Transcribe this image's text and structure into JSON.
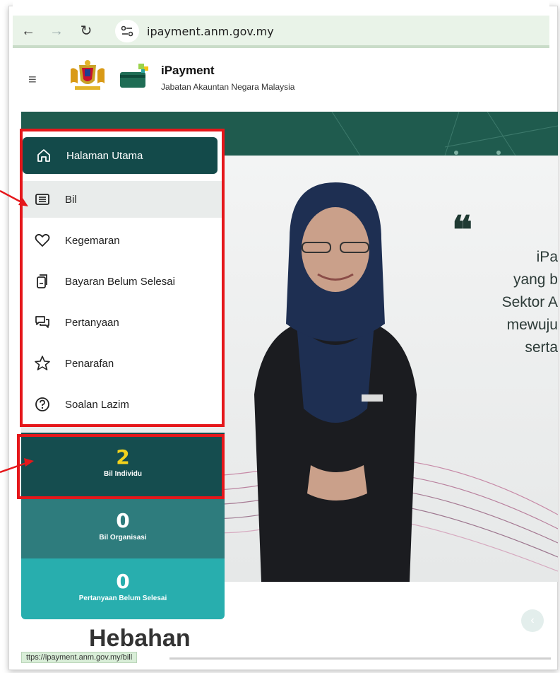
{
  "browser": {
    "url": "ipayment.anm.gov.my",
    "status_url": "ttps://ipayment.anm.gov.my/bill"
  },
  "header": {
    "title": "iPayment",
    "subtitle": "Jabatan Akauntan Negara Malaysia"
  },
  "sidebar": {
    "items": [
      {
        "label": "Halaman Utama",
        "icon": "home-icon"
      },
      {
        "label": "Bil",
        "icon": "bill-list-icon"
      },
      {
        "label": "Kegemaran",
        "icon": "heart-icon"
      },
      {
        "label": "Bayaran Belum Selesai",
        "icon": "pending-document-icon"
      },
      {
        "label": "Pertanyaan",
        "icon": "chat-icon"
      },
      {
        "label": "Penarafan",
        "icon": "star-icon"
      },
      {
        "label": "Soalan Lazim",
        "icon": "question-icon"
      }
    ]
  },
  "stats": [
    {
      "value": "2",
      "label": "Bil Individu"
    },
    {
      "value": "0",
      "label": "Bil Organisasi"
    },
    {
      "value": "0",
      "label": "Pertanyaan Belum Selesai"
    }
  ],
  "hero": {
    "quote_mark": "❝",
    "quote_lines": [
      "iPa",
      "yang b",
      "Sektor A",
      "mewuju",
      "serta"
    ]
  },
  "section": {
    "title": "Hebahan"
  },
  "colors": {
    "active_menu": "#134a4a",
    "stat_1": "#154d4f",
    "stat_2": "#2e7c7d",
    "stat_3": "#28aeae",
    "stat_highlight": "#f2d21d",
    "annotation": "#e5171b"
  }
}
